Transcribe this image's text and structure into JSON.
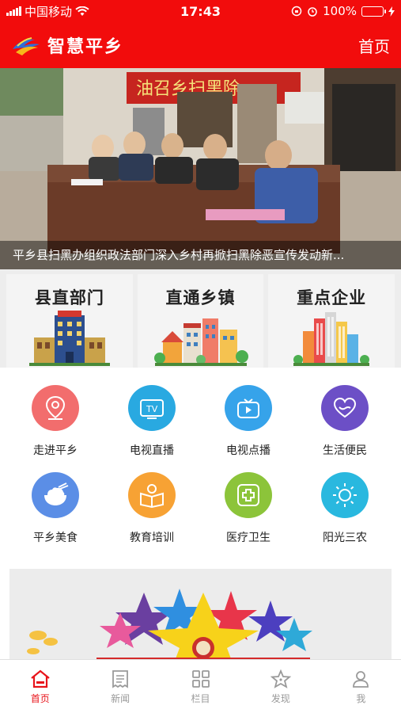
{
  "status_bar": {
    "carrier": "中国移动",
    "time": "17:43",
    "battery_percent": "100%",
    "battery_level": 1.0,
    "battery_color": "#3bd65a"
  },
  "header": {
    "title": "智慧平乡",
    "home_label": "首页",
    "bg_color": "#f20c0c"
  },
  "banner": {
    "sign_text": "油召乡扫黑除",
    "caption": "平乡县扫黑办组织政法部门深入乡村再掀扫黑除恶宣传发动新..."
  },
  "categories": [
    {
      "label": "县直部门",
      "icon": "government-building-icon"
    },
    {
      "label": "直通乡镇",
      "icon": "town-houses-icon"
    },
    {
      "label": "重点企业",
      "icon": "city-skyline-icon"
    }
  ],
  "services": [
    {
      "label": "走进平乡",
      "icon": "location-pin-icon",
      "color": "#f26d6d"
    },
    {
      "label": "电视直播",
      "icon": "tv-icon",
      "color": "#29a9e1"
    },
    {
      "label": "电视点播",
      "icon": "video-play-icon",
      "color": "#36a3ea"
    },
    {
      "label": "生活便民",
      "icon": "heart-hands-icon",
      "color": "#6c4fc6"
    },
    {
      "label": "平乡美食",
      "icon": "rice-bowl-icon",
      "color": "#5b8ee6"
    },
    {
      "label": "教育培训",
      "icon": "reading-book-icon",
      "color": "#f7a234"
    },
    {
      "label": "医疗卫生",
      "icon": "medical-cross-icon",
      "color": "#8cc43a"
    },
    {
      "label": "阳光三农",
      "icon": "sun-icon",
      "color": "#29b8df"
    }
  ],
  "tabbar": {
    "items": [
      {
        "label": "首页",
        "icon": "home-icon",
        "active": true
      },
      {
        "label": "新闻",
        "icon": "newspaper-icon",
        "active": false
      },
      {
        "label": "栏目",
        "icon": "grid-icon",
        "active": false
      },
      {
        "label": "发现",
        "icon": "discover-star-icon",
        "active": false
      },
      {
        "label": "我",
        "icon": "user-icon",
        "active": false
      }
    ],
    "active_color": "#e8141b",
    "inactive_color": "#999999"
  }
}
